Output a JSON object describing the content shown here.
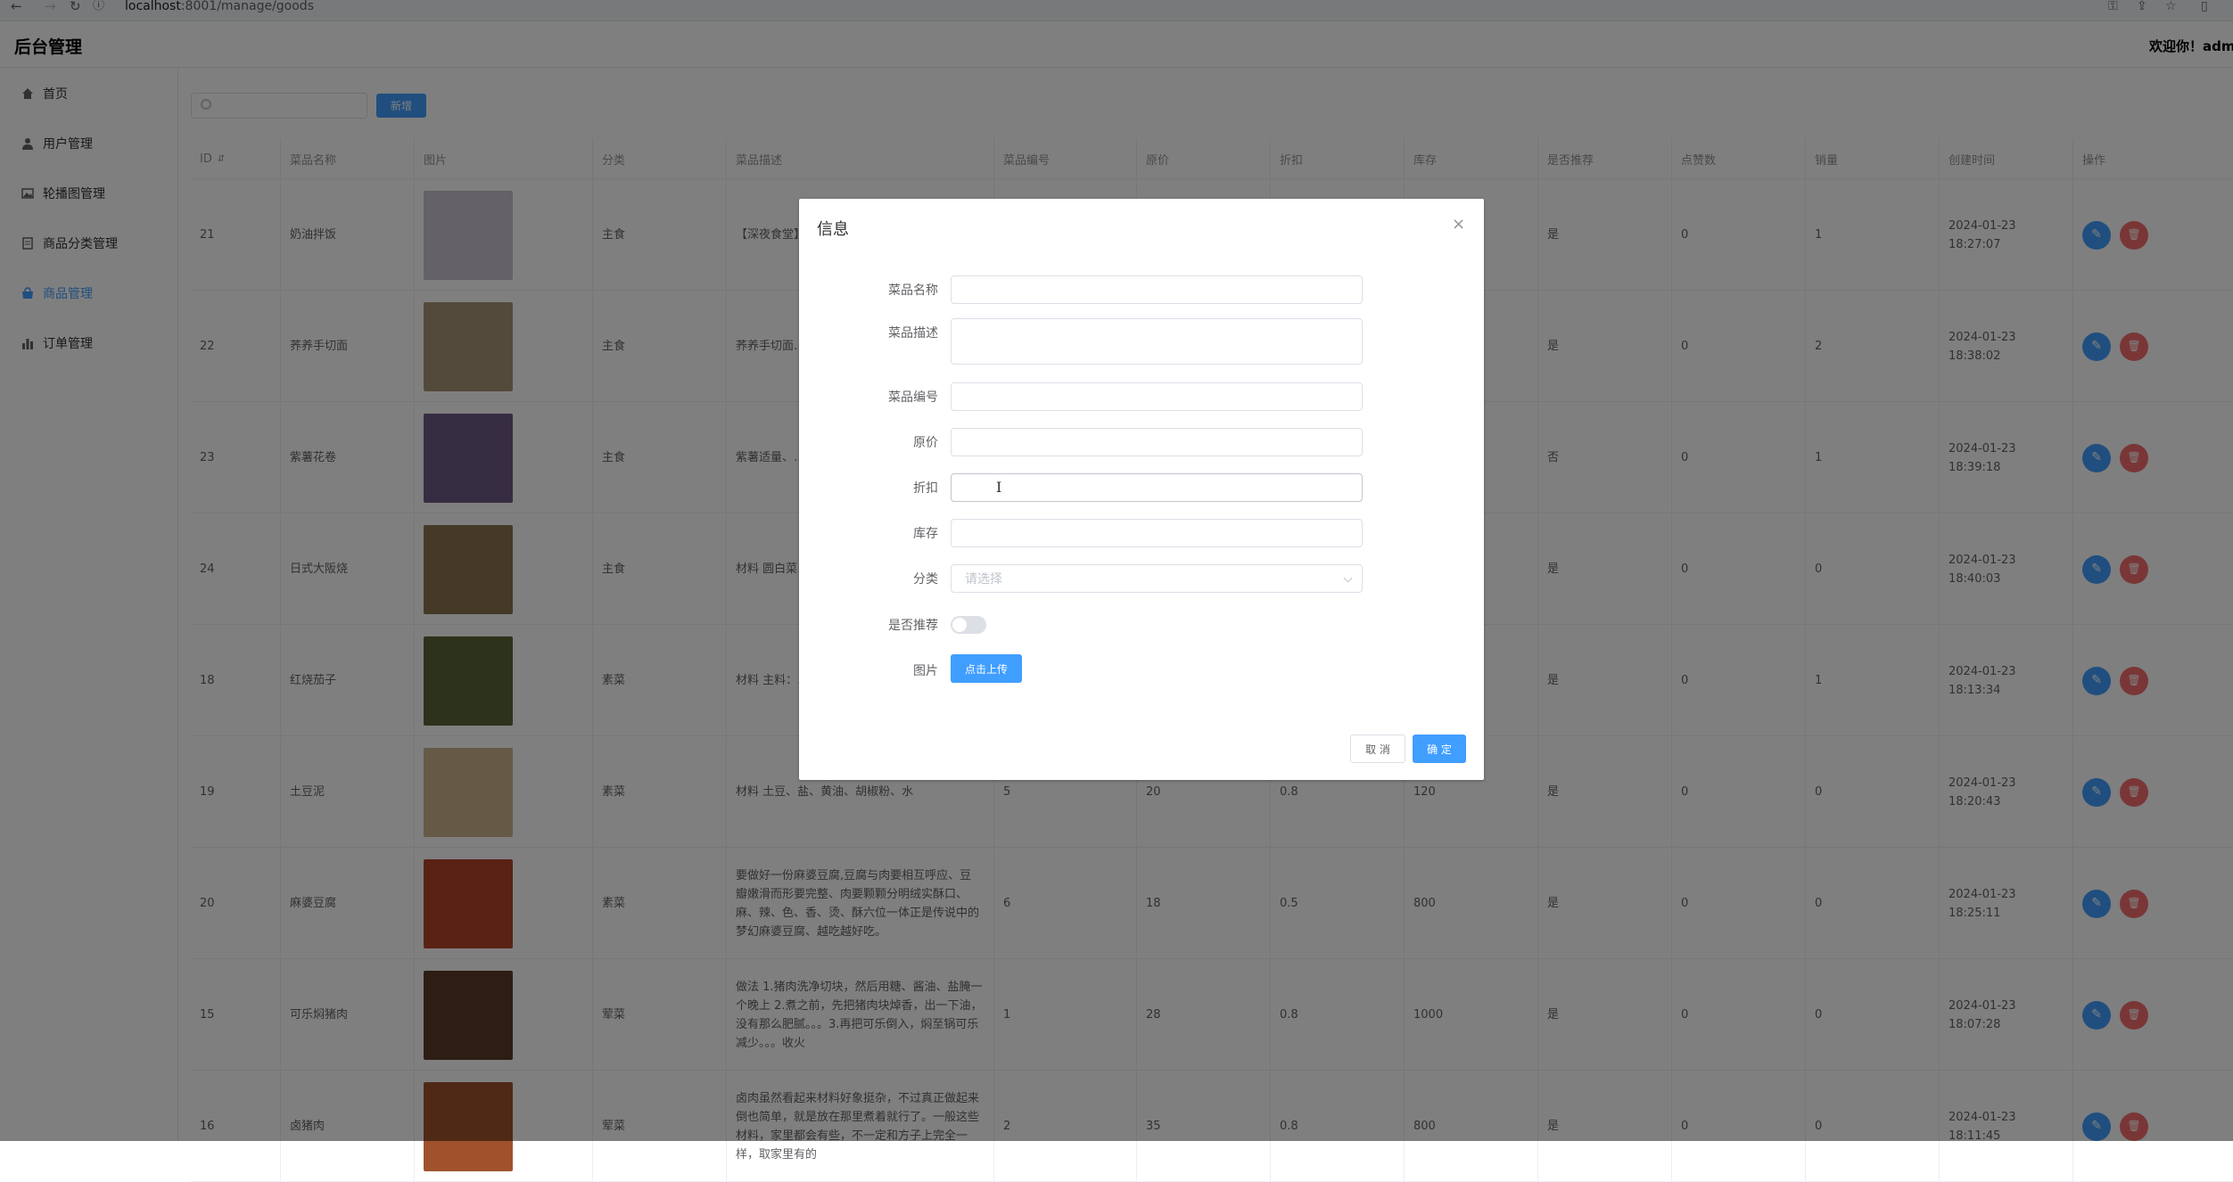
{
  "browser": {
    "back_icon": "←",
    "forward_icon": "→",
    "reload_icon": "↻",
    "info_icon": "ⓘ",
    "url_host": "localhost",
    "url_path": ":8001/manage/goods"
  },
  "header": {
    "brand": "后台管理",
    "welcome": "欢迎你！admin"
  },
  "sidebar": {
    "items": [
      {
        "label": "首页",
        "icon": "home-icon"
      },
      {
        "label": "用户管理",
        "icon": "user-icon"
      },
      {
        "label": "轮播图管理",
        "icon": "picture-icon"
      },
      {
        "label": "商品分类管理",
        "icon": "document-icon"
      },
      {
        "label": "商品管理",
        "icon": "shop-bag-icon",
        "active": true
      },
      {
        "label": "订单管理",
        "icon": "bar-chart-icon"
      }
    ]
  },
  "toolbar": {
    "search_placeholder": "",
    "add_label": "新增"
  },
  "table": {
    "headers": [
      "ID",
      "菜品名称",
      "图片",
      "分类",
      "菜品描述",
      "菜品编号",
      "原价",
      "折扣",
      "库存",
      "是否推荐",
      "点赞数",
      "销量",
      "创建时间",
      "操作"
    ],
    "rows": [
      {
        "id": "21",
        "name": "奶油拌饭",
        "category": "主食",
        "desc": "【深夜食堂】…magic的饭料…又西又中的调…",
        "code": "",
        "price": "",
        "discount": "",
        "stock": "",
        "recommend": "是",
        "likes": "0",
        "sales": "1",
        "time": "2024-01-23 18:27:07",
        "img": "#c9c2cf"
      },
      {
        "id": "22",
        "name": "荞养手切面",
        "category": "主食",
        "desc": "荞养手切面…",
        "code": "",
        "price": "",
        "discount": "",
        "stock": "",
        "recommend": "是",
        "likes": "0",
        "sales": "2",
        "time": "2024-01-23 18:38:02",
        "img": "#a89476"
      },
      {
        "id": "23",
        "name": "紫薯花卷",
        "category": "主食",
        "desc": "紫薯适量、…",
        "code": "",
        "price": "",
        "discount": "",
        "stock": "",
        "recommend": "否",
        "likes": "0",
        "sales": "1",
        "time": "2024-01-23 18:39:18",
        "img": "#6e5a84"
      },
      {
        "id": "24",
        "name": "日式大阪烧",
        "category": "主食",
        "desc": "材料 圆白菜…",
        "code": "",
        "price": "",
        "discount": "",
        "stock": "",
        "recommend": "是",
        "likes": "0",
        "sales": "0",
        "time": "2024-01-23 18:40:03",
        "img": "#8a7450"
      },
      {
        "id": "18",
        "name": "红烧茄子",
        "category": "素菜",
        "desc": "材料 主料：…盐、水、油",
        "code": "",
        "price": "",
        "discount": "",
        "stock": "",
        "recommend": "是",
        "likes": "0",
        "sales": "1",
        "time": "2024-01-23 18:13:34",
        "img": "#5b6438"
      },
      {
        "id": "19",
        "name": "土豆泥",
        "category": "素菜",
        "desc": "材料 土豆、盐、黄油、胡椒粉、水",
        "code": "5",
        "price": "20",
        "discount": "0.8",
        "stock": "120",
        "recommend": "是",
        "likes": "0",
        "sales": "0",
        "time": "2024-01-23 18:20:43",
        "img": "#c9b58c"
      },
      {
        "id": "20",
        "name": "麻婆豆腐",
        "category": "素菜",
        "desc": "要做好一份麻婆豆腐,豆腐与肉要相互呼应、豆瓣嫩滑而形要完整、肉要颗颗分明绒实酥口、麻、辣、色、香、烫、酥六位一体正是传说中的梦幻麻婆豆腐、越吃越好吃。",
        "code": "6",
        "price": "18",
        "discount": "0.5",
        "stock": "800",
        "recommend": "是",
        "likes": "0",
        "sales": "0",
        "time": "2024-01-23 18:25:11",
        "img": "#b4452a"
      },
      {
        "id": "15",
        "name": "可乐焖猪肉",
        "category": "荤菜",
        "desc": "做法 1.猪肉洗净切块，然后用糖、酱油、盐腌一个晚上 2.煮之前，先把猪肉块焯香，出一下油，没有那么肥腻。。。3.再把可乐倒入，焖至锅可乐减少。。。收火",
        "code": "1",
        "price": "28",
        "discount": "0.8",
        "stock": "1000",
        "recommend": "是",
        "likes": "0",
        "sales": "0",
        "time": "2024-01-23 18:07:28",
        "img": "#5a3a2a"
      },
      {
        "id": "16",
        "name": "卤猪肉",
        "category": "荤菜",
        "desc": "卤肉虽然看起来材料好象挺杂，不过真正做起来倒也简单，就是放在那里煮着就行了。一般这些材料，家里都会有些，不一定和方子上完全一样，取家里有的",
        "code": "2",
        "price": "35",
        "discount": "0.8",
        "stock": "800",
        "recommend": "是",
        "likes": "0",
        "sales": "0",
        "time": "2024-01-23 18:11:45",
        "img": "#a0522d"
      }
    ]
  },
  "dialog": {
    "title": "信息",
    "close_icon": "×",
    "fields": {
      "name_label": "菜品名称",
      "desc_label": "菜品描述",
      "code_label": "菜品编号",
      "price_label": "原价",
      "discount_label": "折扣",
      "stock_label": "库存",
      "category_label": "分类",
      "category_placeholder": "请选择",
      "recommend_label": "是否推荐",
      "recommend_on": false,
      "image_label": "图片",
      "upload_label": "点击上传"
    },
    "cancel_label": "取 消",
    "confirm_label": "确 定"
  },
  "colors": {
    "primary": "#409eff",
    "danger": "#f56c6c",
    "overlay": "rgba(0,0,0,0.5)"
  }
}
